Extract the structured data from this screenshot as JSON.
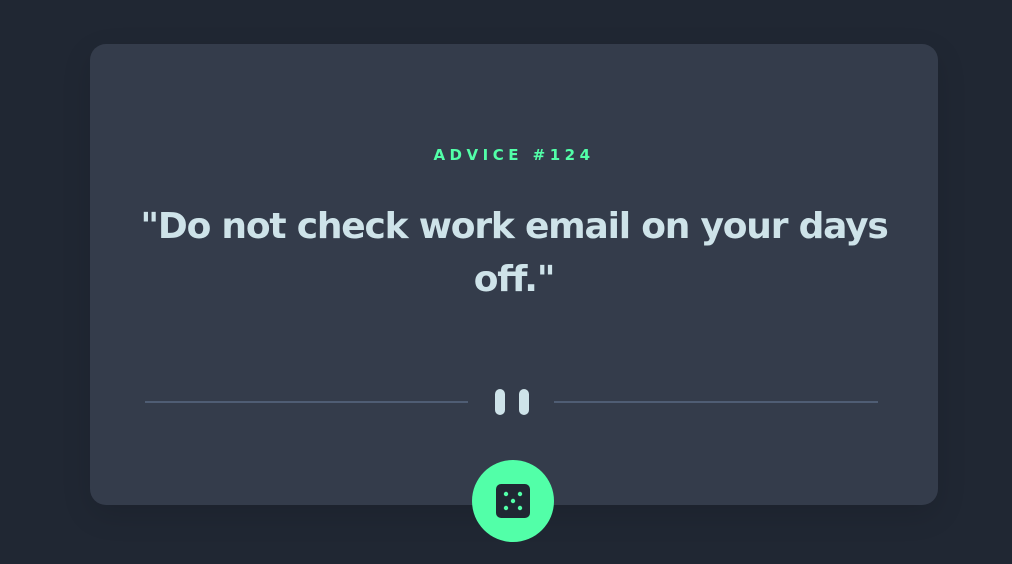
{
  "advice": {
    "id_label": "ADVICE #124",
    "quote": "\"Do not check work email on your days off.\""
  },
  "icons": {
    "divider": "pause-icon",
    "button": "dice-icon"
  },
  "colors": {
    "background": "#202733",
    "card": "#343c4b",
    "accent": "#52ffa8",
    "text": "#cee3e9",
    "divider": "#4f5d74"
  }
}
